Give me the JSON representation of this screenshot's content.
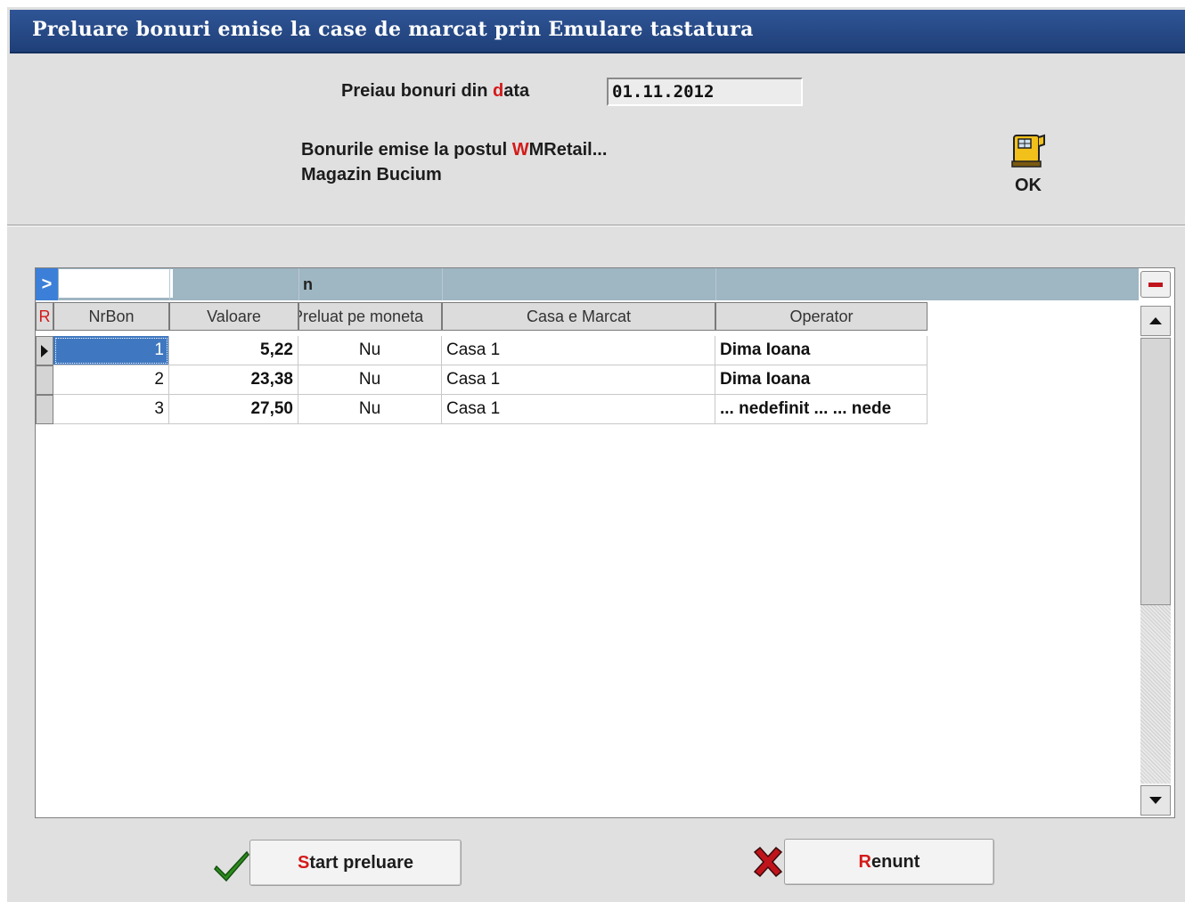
{
  "window": {
    "title": "Preluare bonuri emise la case de marcat prin Emulare tastatura"
  },
  "date_section": {
    "label_prefix": "Preiau bonuri din ",
    "label_highlight": "d",
    "label_suffix": "ata",
    "value": "01.11.2012"
  },
  "info": {
    "line1_prefix": "Bonurile emise la postul ",
    "line1_highlight": "W",
    "line1_suffix": "MRetail...",
    "line2": "Magazin Bucium"
  },
  "ok_button": {
    "label": "OK",
    "icon": "cash-register-icon"
  },
  "grid": {
    "filter_toggle": ">",
    "filter_col_text": "n",
    "row_marker_header": "R",
    "columns": [
      "NrBon",
      "Valoare",
      "Preluat pe moneta",
      "Casa e Marcat",
      "Operator"
    ],
    "rows": [
      {
        "nrbon": "1",
        "valoare": "5,22",
        "preluat": "Nu",
        "casa": "Casa 1",
        "operator": "Dima Ioana"
      },
      {
        "nrbon": "2",
        "valoare": "23,38",
        "preluat": "Nu",
        "casa": "Casa 1",
        "operator": "Dima Ioana"
      },
      {
        "nrbon": "3",
        "valoare": "27,50",
        "preluat": "Nu",
        "casa": "Casa 1",
        "operator": "... nedefinit ... ... nede"
      }
    ],
    "selected_row": 1
  },
  "buttons": {
    "start": {
      "first": "S",
      "rest": "tart preluare",
      "icon": "checkmark-icon",
      "icon_color": "#2e8b1e"
    },
    "cancel": {
      "first": "R",
      "rest": "enunt",
      "icon": "x-mark-icon",
      "icon_color": "#c0141c"
    }
  }
}
